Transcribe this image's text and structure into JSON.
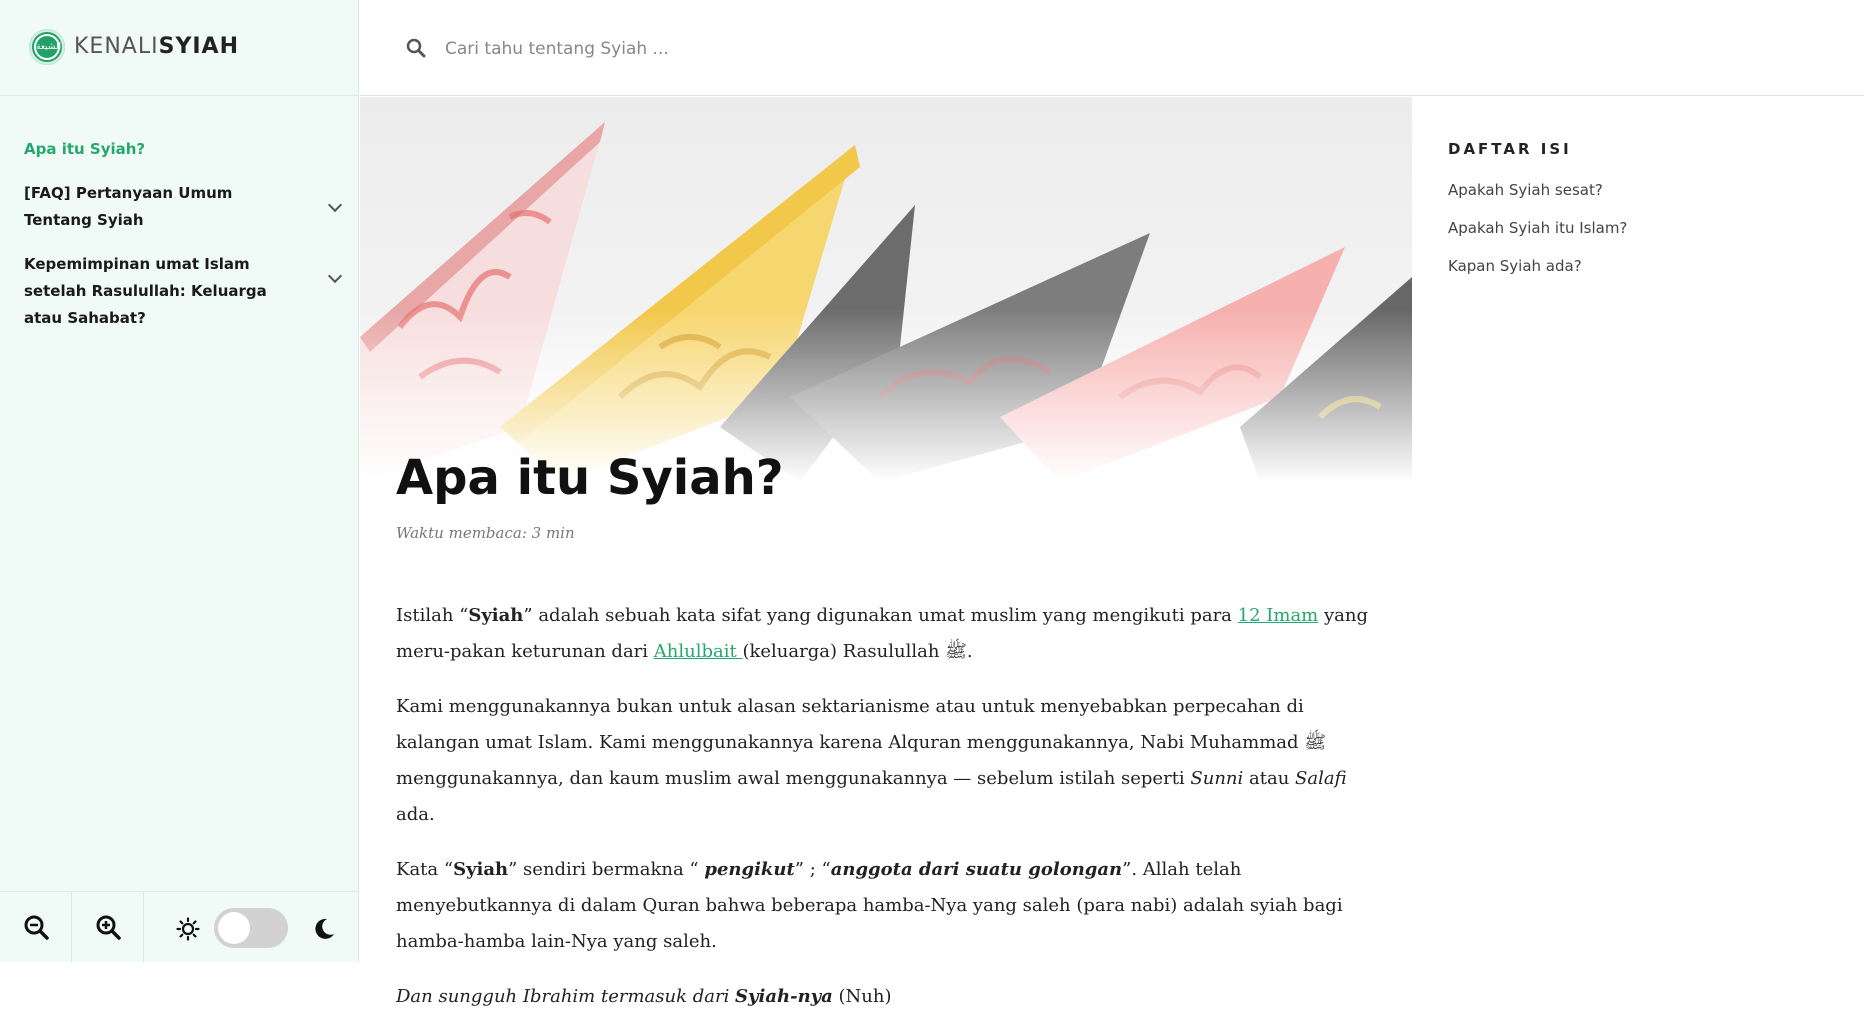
{
  "brand": {
    "prefix": "KENALI",
    "name": "SYIAH",
    "logo_text": "الشيعة"
  },
  "search": {
    "placeholder": "Cari tahu tentang Syiah ..."
  },
  "sidebar": {
    "items": [
      {
        "label": "Apa itu Syiah?",
        "active": true,
        "expandable": false
      },
      {
        "label": "[FAQ] Pertanyaan Umum Tentang Syiah",
        "active": false,
        "expandable": true
      },
      {
        "label": "Kepemimpinan umat Islam setelah Rasulullah: Keluarga atau Sahabat?",
        "active": false,
        "expandable": true
      }
    ],
    "footer": {
      "zoom_out": "zoom-out",
      "zoom_in": "zoom-in",
      "light": "sun",
      "dark": "moon",
      "dark_mode_on": false
    }
  },
  "article": {
    "title": "Apa itu Syiah?",
    "reading_time": "Waktu membaca: 3 min",
    "p1": {
      "t1": "Istilah “",
      "b1": "Syiah",
      "t2": "” adalah sebuah kata sifat yang digunakan umat muslim yang mengikuti para ",
      "link1": "12 Imam",
      "t3": " yang meru-pakan keturunan dari ",
      "link2": "Ahlulbait ",
      "t4": "(keluarga) Rasulullah ﷺ."
    },
    "p2": {
      "t1": "Kami menggunakannya bukan untuk alasan sektarianisme atau untuk menyebabkan perpecahan di kalangan umat Islam. Kami menggunakannya karena Alquran menggunakannya, Nabi Muhammad ﷺ menggunakannya, dan kaum muslim awal menggunakannya — sebelum istilah seperti ",
      "i1": "Sunni",
      "t2": " atau ",
      "i2": "Salafi",
      "t3": " ada."
    },
    "p3": {
      "t1": "Kata “",
      "b1": "Syiah",
      "t2": "” sendiri bermakna “ ",
      "bi1": "pengikut",
      "t3": "” ; “",
      "bi2": "anggota dari suatu golongan",
      "t4": "”.  Allah telah menyebutkannya di dalam Quran bahwa beberapa hamba-Nya yang saleh (para nabi) adalah syiah bagi hamba-hamba lain-Nya yang saleh."
    },
    "quote": {
      "t1": "Dan sungguh Ibrahim termasuk dari ",
      "b1": "Syiah-nya",
      "t2": " (Nuh)"
    }
  },
  "toc": {
    "title": "DAFTAR ISI",
    "items": [
      "Apakah Syiah sesat?",
      "Apakah Syiah itu Islam?",
      "Kapan Syiah ada?"
    ]
  },
  "colors": {
    "accent": "#25a86e",
    "sidebar_bg": "#f0fbf7",
    "border": "#d6ece3"
  }
}
